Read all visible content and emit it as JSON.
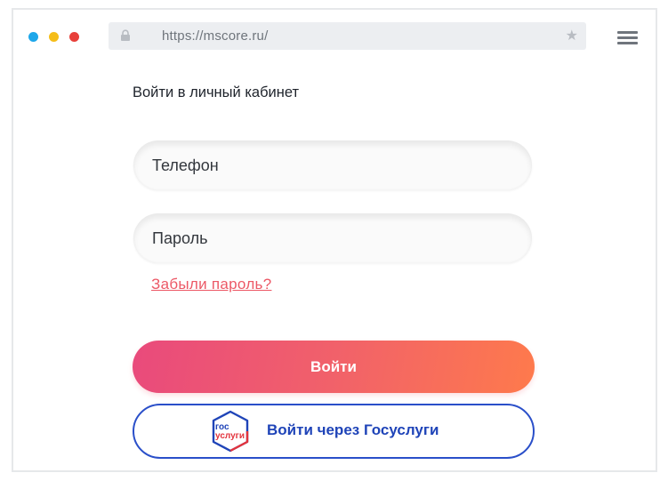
{
  "browser": {
    "url": "https://mscore.ru/",
    "icons": {
      "lock": "lock-icon",
      "star": "star-icon",
      "menu": "hamburger-menu-icon"
    },
    "traffic_lights": {
      "blue": "#1ea7ea",
      "yellow": "#f5bd19",
      "red": "#e8403a"
    }
  },
  "login": {
    "title": "Войти в личный кабинет",
    "phone_placeholder": "Телефон",
    "password_placeholder": "Пароль",
    "forgot_link": "Забыли пароль?",
    "submit_label": "Войти",
    "gosuslugi_label": "Войти через Госуслуги",
    "gosuslugi_logo_text": [
      "гос",
      "услуги"
    ]
  },
  "colors": {
    "accent_pink": "#e94a7c",
    "accent_orange": "#fe7a4c",
    "link_red": "#ec5866",
    "gos_blue": "#2a4fc9",
    "gos_red": "#e3333c"
  }
}
